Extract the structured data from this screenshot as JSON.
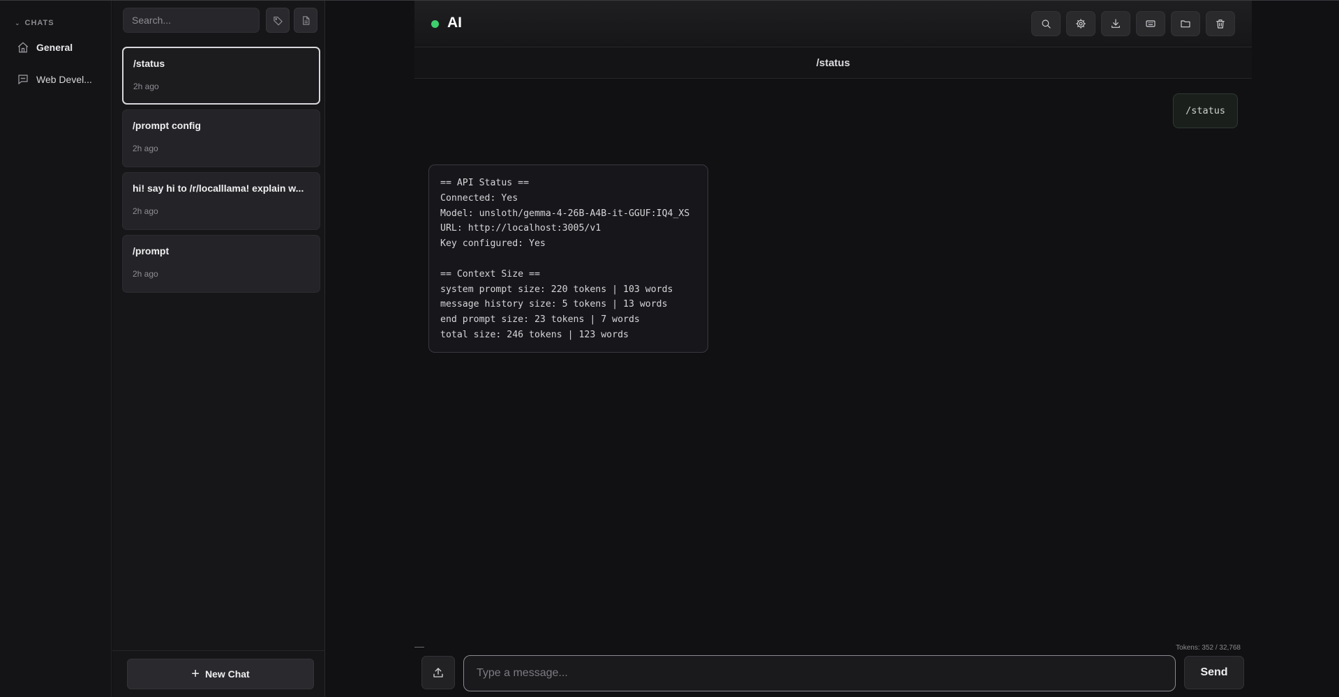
{
  "sidebar": {
    "section_label": "CHATS",
    "items": [
      {
        "label": "General",
        "icon": "home-icon"
      },
      {
        "label": "Web Devel..."
      }
    ]
  },
  "chat_list": {
    "search_placeholder": "Search...",
    "chats": [
      {
        "title": "/status",
        "time": "2h ago",
        "active": true
      },
      {
        "title": "/prompt config",
        "time": "2h ago"
      },
      {
        "title": "hi! say hi to /r/localllama! explain w...",
        "time": "2h ago"
      },
      {
        "title": "/prompt",
        "time": "2h ago"
      }
    ],
    "new_chat_label": "New Chat"
  },
  "header": {
    "title": "AI",
    "status_color": "#3ecf6e",
    "buttons": [
      "search-icon",
      "gear-icon",
      "download-icon",
      "keyboard-icon",
      "folder-icon",
      "trash-icon"
    ]
  },
  "conversation": {
    "title": "/status",
    "messages": [
      {
        "role": "user",
        "text": "/status"
      },
      {
        "role": "assistant",
        "text": "== API Status ==\nConnected: Yes\nModel: unsloth/gemma-4-26B-A4B-it-GGUF:IQ4_XS\nURL: http://localhost:3005/v1\nKey configured: Yes\n\n== Context Size ==\nsystem prompt size: 220 tokens | 103 words\nmessage history size: 5 tokens | 13 words\nend prompt size: 23 tokens | 7 words\ntotal size: 246 tokens | 123 words"
      }
    ]
  },
  "composer": {
    "token_count": "Tokens: 352 / 32,768",
    "placeholder": "Type a message...",
    "value": "",
    "send_label": "Send"
  }
}
